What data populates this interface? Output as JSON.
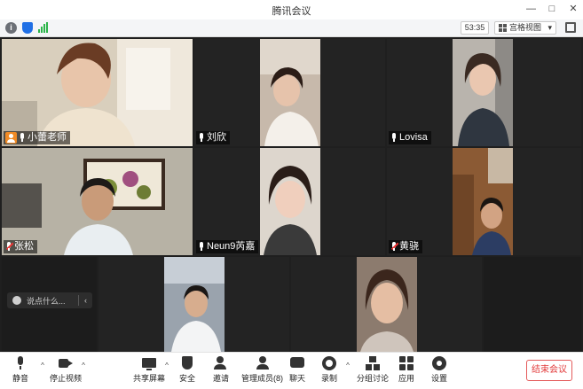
{
  "window": {
    "title": "腾讯会议",
    "controls": [
      "—",
      "□",
      "✕"
    ]
  },
  "infobar": {
    "timer": "53:35",
    "view_label": "宫格视图",
    "view_caret": "▾"
  },
  "participants": [
    {
      "name": "小蕾老师",
      "mic": "on",
      "host": true,
      "active": true,
      "bg": "#cbbfa9",
      "skin": "#e8c5aa"
    },
    {
      "name": "刘欣",
      "mic": "on",
      "host": false,
      "active": false,
      "bg": "#c8b8a8",
      "skin": "#e6c3ab"
    },
    {
      "name": "Lovisa",
      "mic": "on",
      "host": false,
      "active": false,
      "bg": "#b9b4ad",
      "skin": "#eac7b0"
    },
    {
      "name": "张松",
      "mic": "muted",
      "host": false,
      "active": false,
      "bg": "#b7b2a5",
      "skin": "#c99b79"
    },
    {
      "name": "Neun9芮嘉",
      "mic": "on",
      "host": false,
      "active": false,
      "bg": "#ddd6cd",
      "skin": "#f0cfbd"
    },
    {
      "name": "黄骁",
      "mic": "muted",
      "host": false,
      "active": false,
      "bg": "#8b5a34",
      "skin": "#d2a383"
    },
    {
      "name": "",
      "mic": "none",
      "host": false,
      "active": false,
      "bg": "#9aa3ad",
      "skin": "#d7ad8e"
    },
    {
      "name": "",
      "mic": "none",
      "host": false,
      "active": false,
      "bg": "#8c7b6e",
      "skin": "#e5bea3"
    }
  ],
  "chat": {
    "placeholder": "说点什么...",
    "collapse": "‹"
  },
  "toolbar": {
    "mute": "静音",
    "stop_video": "停止视频",
    "share_screen": "共享屏幕",
    "security": "安全",
    "invite": "邀请",
    "manage_members": "管理成员(8)",
    "chat": "聊天",
    "record": "录制",
    "breakout": "分组讨论",
    "apps": "应用",
    "settings": "设置",
    "end_meeting": "结束会议",
    "caret": "^"
  },
  "colors": {
    "accent": "#2bb673",
    "host_badge": "#f08a24",
    "end_meeting": "#e23b3b",
    "shield": "#1f6fe5",
    "signal": "#2cb54a"
  },
  "icons": {
    "info": "info-icon",
    "shield": "shield-icon",
    "signal": "signal-icon",
    "grid": "grid-view-icon",
    "fullscreen": "fullscreen-icon",
    "mic": "microphone-icon",
    "camera": "camera-icon",
    "share": "screen-share-icon",
    "security": "shield-icon",
    "invite": "add-user-icon",
    "members": "members-icon",
    "chat": "chat-icon",
    "record": "record-icon",
    "breakout": "breakout-room-icon",
    "apps": "apps-icon",
    "settings": "gear-icon"
  }
}
